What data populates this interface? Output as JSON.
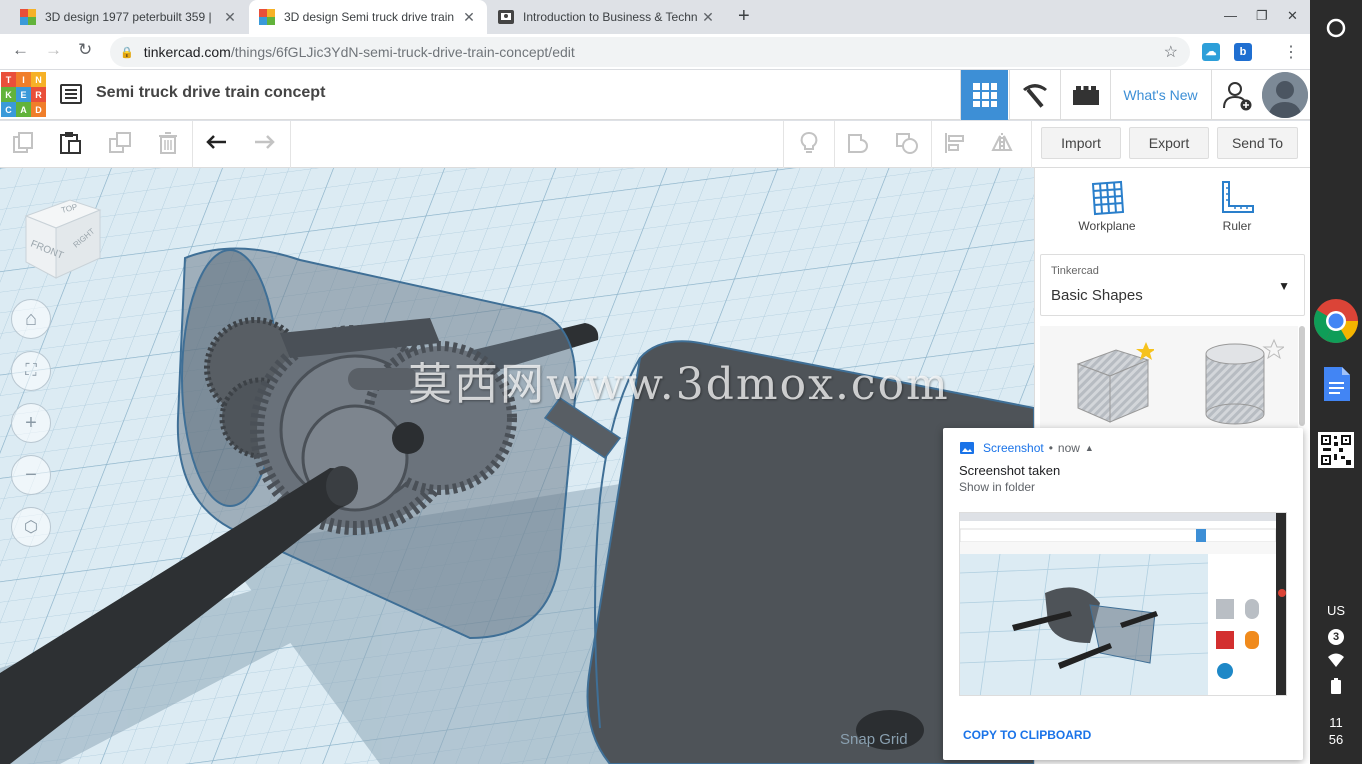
{
  "browser": {
    "tabs": [
      {
        "title": "3D design 1977 peterbuilt 359 |",
        "close": "✕",
        "active": false
      },
      {
        "title": "3D design Semi truck drive train",
        "close": "✕",
        "active": true
      },
      {
        "title": "Introduction to Business & Techn",
        "close": "✕",
        "active": false
      }
    ],
    "new_tab": "+",
    "url_domain": "tinkercad.com",
    "url_path": "/things/6fGLJic3YdN-semi-truck-drive-train-concept/edit"
  },
  "app": {
    "logo_letters": [
      "TIN",
      "KER",
      "CAD"
    ],
    "design_title": "Semi truck drive train concept",
    "whats_new": "What's New"
  },
  "toolbar": {
    "import": "Import",
    "export": "Export",
    "send_to": "Send To"
  },
  "viewcube": {
    "top": "TOP",
    "front": "FRONT",
    "right": "RIGHT"
  },
  "viewport": {
    "watermark": "莫西网www.3dmox.com",
    "snap_grid": "Snap Grid"
  },
  "panel": {
    "workplane": "Workplane",
    "ruler": "Ruler",
    "library_sub": "Tinkercad",
    "library_value": "Basic Shapes"
  },
  "notification": {
    "app": "Screenshot",
    "time": "now",
    "title": "Screenshot taken",
    "subtitle": "Show in folder",
    "action": "COPY TO CLIPBOARD"
  },
  "shelf": {
    "keyboard": "US",
    "badge": "3",
    "time_hour": "11",
    "time_min": "56"
  },
  "colors": {
    "accent": "#3d8fd6",
    "grid_bg": "#cfe3ee",
    "notif_link": "#1a73e8"
  }
}
